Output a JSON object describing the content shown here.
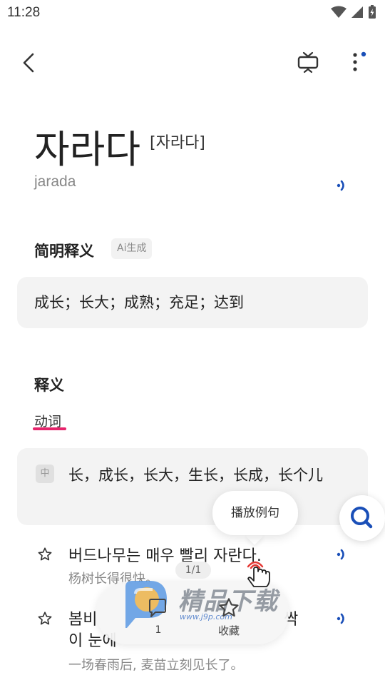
{
  "status_bar": {
    "time": "11:28"
  },
  "entry": {
    "headword": "자라다",
    "pronunciation": "[자라다]",
    "romanization": "jarada"
  },
  "brief": {
    "title": "简明释义",
    "badge": "Ai生成",
    "text": "成长；长大；成熟；充足；达到"
  },
  "definitions": {
    "title": "释义",
    "pos": "动词",
    "lang_badge": "中",
    "text": "长，成长，长大，生长，长成，长个儿"
  },
  "examples": [
    {
      "kr": "버드나무는 매우 빨리 자란다.",
      "zh": "杨树长得很快。"
    },
    {
      "kr_line1": "봄비",
      "kr_line1_end": "싹",
      "kr_line2": "이 눈에",
      "zh": "一场春雨后, 麦苗立刻见长了。"
    }
  ],
  "tooltip": {
    "label": "播放例句"
  },
  "bottom_bar": {
    "page_indicator": "1/1",
    "comment_count": "1",
    "favorite_label": "收藏"
  },
  "watermark": {
    "brand": "精品下载",
    "url": "www.j9p.com"
  },
  "colors": {
    "accent_blue": "#1a4fb8",
    "pos_underline": "#e6246b",
    "notification_dot": "#1a4fb8"
  },
  "icons": [
    "back-icon",
    "tv-icon",
    "more-icon",
    "speaker-icon",
    "star-icon",
    "search-icon",
    "comment-icon"
  ]
}
